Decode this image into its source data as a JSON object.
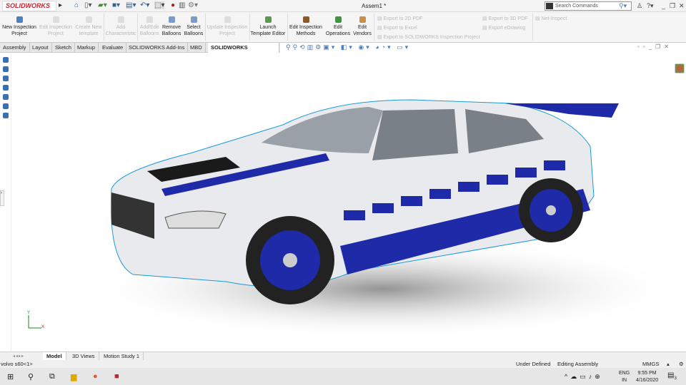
{
  "app": {
    "logo": "SOLIDWORKS",
    "title": "Assem1 *",
    "search_placeholder": "Search Commands"
  },
  "ribbon": {
    "buttons": [
      {
        "label": "New Inspection Project",
        "enabled": true
      },
      {
        "label": "Edit Inspection Project",
        "enabled": false
      },
      {
        "label": "Create New template",
        "enabled": false
      },
      {
        "label": "Add Characteristic",
        "enabled": false
      },
      {
        "label": "Add/Edit Balloons",
        "enabled": false
      },
      {
        "label": "Remove Balloons",
        "enabled": true
      },
      {
        "label": "Select Balloons",
        "enabled": true
      },
      {
        "label": "Update Inspection Project",
        "enabled": false
      },
      {
        "label": "Launch Template Editor",
        "enabled": true
      },
      {
        "label": "Edit Inspection Methods",
        "enabled": true
      },
      {
        "label": "Edit Operations",
        "enabled": true
      },
      {
        "label": "Edit Vendors",
        "enabled": true
      }
    ],
    "exports": [
      "Export to 2D PDF",
      "Export to Excel",
      "Export to SOLIDWORKS Inspection Project",
      "Export to 3D PDF",
      "Export eDrawing",
      "Net-Inspect"
    ]
  },
  "tabs": [
    "Assembly",
    "Layout",
    "Sketch",
    "Markup",
    "Evaluate",
    "SOLIDWORKS Add-Ins",
    "MBD",
    "SOLIDWORKS Inspection"
  ],
  "active_tab": "SOLIDWORKS Inspection",
  "bottom_tabs": [
    "Model",
    "3D Views",
    "Motion Study 1"
  ],
  "status": {
    "component": "volvo s60<1>",
    "state": "Under Defined",
    "mode": "Editing Assembly",
    "units": "MMGS"
  },
  "taskbar": {
    "lang1": "ENG",
    "lang2": "IN",
    "time": "9:55 PM",
    "date": "4/16/2020",
    "notifications": "3"
  }
}
